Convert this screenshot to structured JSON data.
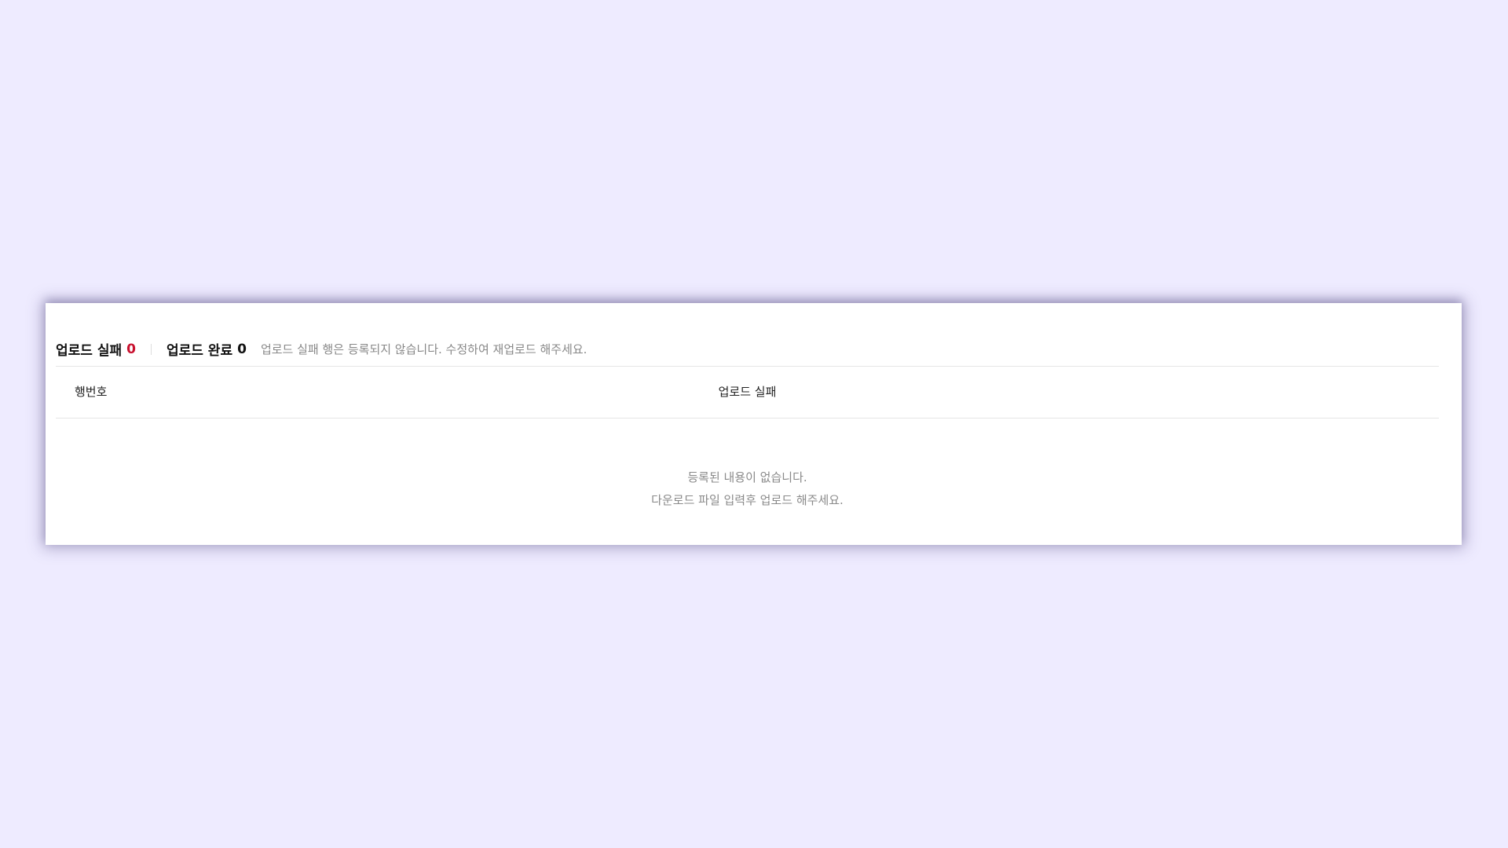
{
  "summary": {
    "fail_label": "업로드 실패",
    "fail_count": "0",
    "done_label": "업로드 완료",
    "done_count": "0",
    "notice": "업로드 실패 행은 등록되지 않습니다. 수정하여 재업로드 해주세요."
  },
  "table": {
    "columns": [
      "행번호",
      "업로드 실패"
    ],
    "rows": []
  },
  "empty_state": {
    "line1": "등록된 내용이 없습니다.",
    "line2": "다운로드 파일 입력후 업로드 해주세요."
  },
  "colors": {
    "background": "#eeebff",
    "fail_accent": "#c8102e",
    "muted_text": "#888888"
  }
}
